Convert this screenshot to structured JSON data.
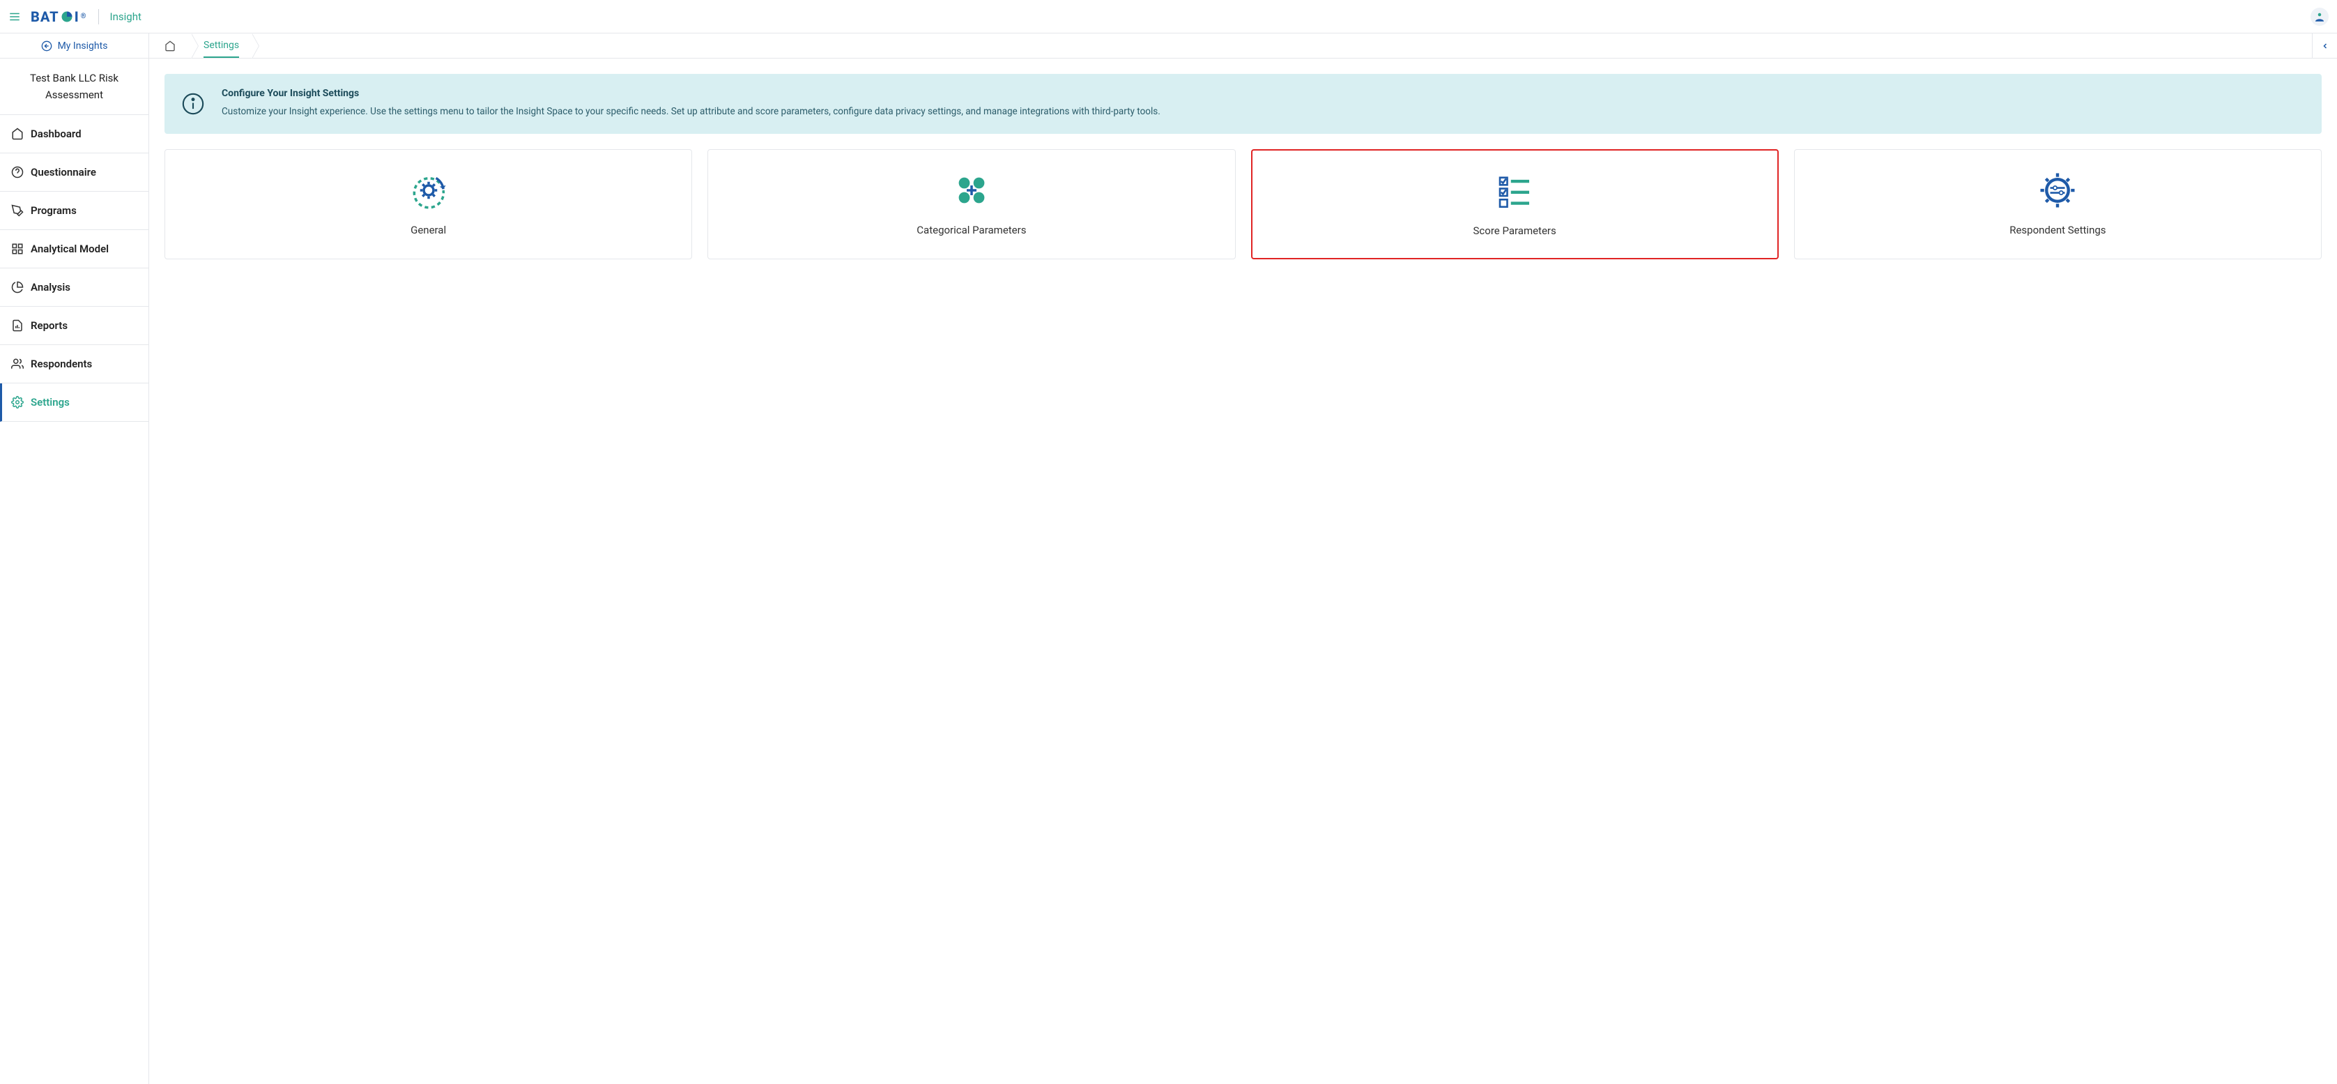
{
  "header": {
    "logo": "BATOI",
    "product": "Insight"
  },
  "sidebar": {
    "my_insights": "My Insights",
    "project": "Test Bank LLC Risk Assessment",
    "items": [
      {
        "label": "Dashboard"
      },
      {
        "label": "Questionnaire"
      },
      {
        "label": "Programs"
      },
      {
        "label": "Analytical Model"
      },
      {
        "label": "Analysis"
      },
      {
        "label": "Reports"
      },
      {
        "label": "Respondents"
      },
      {
        "label": "Settings"
      }
    ]
  },
  "breadcrumb": {
    "settings": "Settings"
  },
  "info": {
    "title": "Configure Your Insight Settings",
    "desc": "Customize your Insight experience. Use the settings menu to tailor the Insight Space to your specific needs. Set up attribute and score parameters, configure data privacy settings, and manage integrations with third-party tools."
  },
  "cards": [
    {
      "label": "General"
    },
    {
      "label": "Categorical Parameters"
    },
    {
      "label": "Score Parameters"
    },
    {
      "label": "Respondent Settings"
    }
  ]
}
